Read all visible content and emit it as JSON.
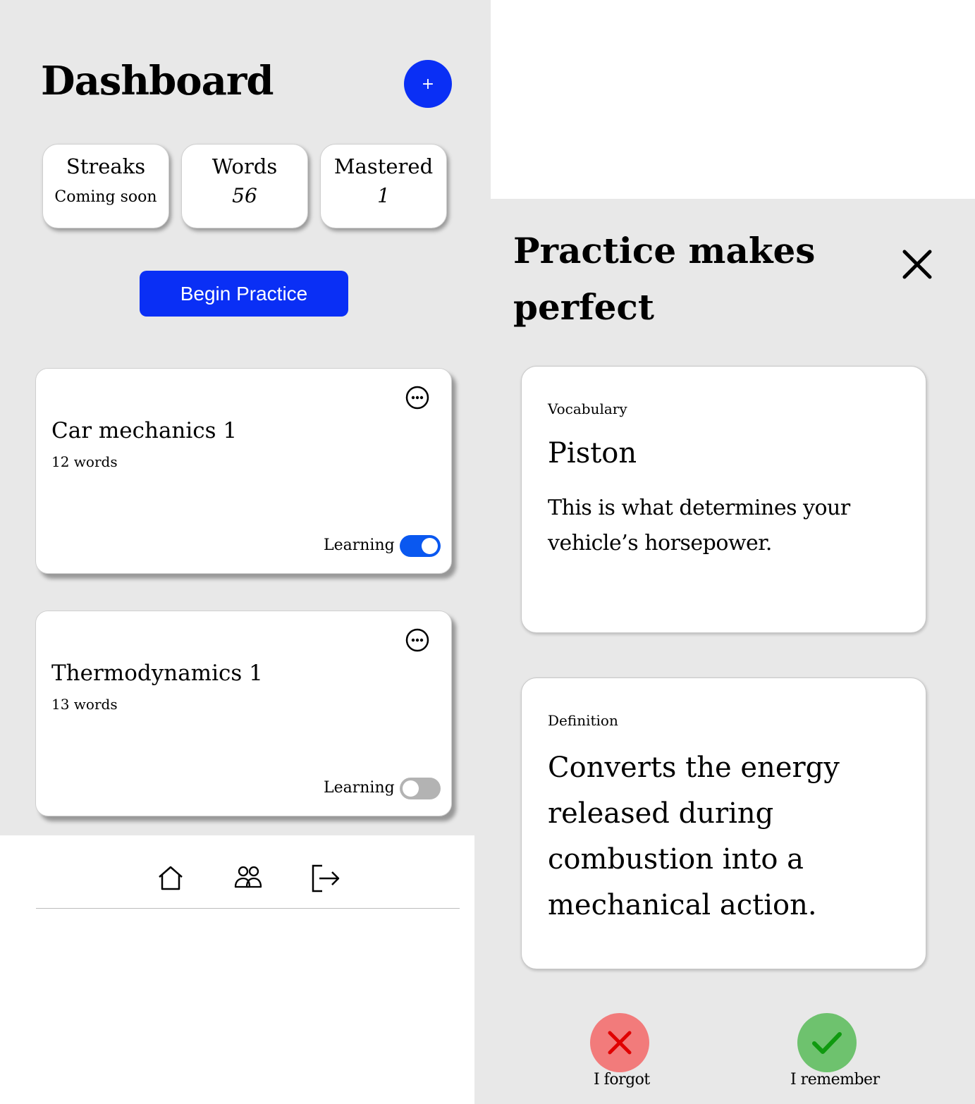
{
  "dashboard": {
    "title": "Dashboard",
    "add_label": "+",
    "stats": [
      {
        "label": "Streaks",
        "value": "Coming soon"
      },
      {
        "label": "Words",
        "value": "56"
      },
      {
        "label": "Mastered",
        "value": "1"
      }
    ],
    "begin_practice_label": "Begin Practice",
    "decks": [
      {
        "title": "Car mechanics 1",
        "count": "12 words",
        "learning_label": "Learning",
        "learning_on": true
      },
      {
        "title": "Thermodynamics 1",
        "count": "13 words",
        "learning_label": "Learning",
        "learning_on": false
      }
    ],
    "nav": [
      "home-icon",
      "users-icon",
      "logout-icon"
    ]
  },
  "practice": {
    "title": "Practice makes perfect",
    "vocab_card": {
      "label": "Vocabulary",
      "word": "Piston",
      "hint": "This is what determines your vehicle’s horsepower."
    },
    "definition_card": {
      "label": "Definition",
      "text": "Converts the energy released during combustion into a mechanical action."
    },
    "forgot_label": "I forgot",
    "remember_label": "I remember"
  },
  "colors": {
    "accent": "#0a2ff5",
    "toggle_on": "#0a58f0",
    "forgot": "#f27b7b",
    "remember": "#6ec26e",
    "panel_bg": "#e8e8e8"
  }
}
